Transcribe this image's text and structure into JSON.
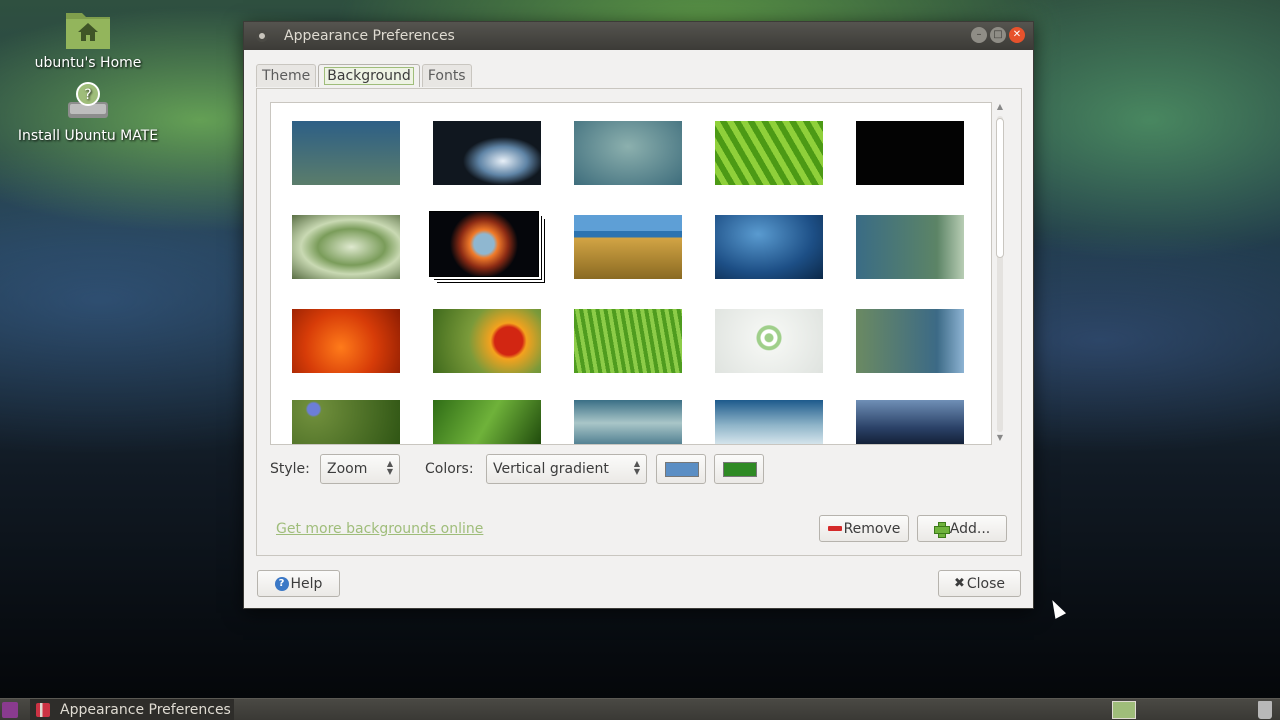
{
  "desktop": {
    "icons": [
      {
        "label": "ubuntu's Home",
        "icon": "home-folder-icon"
      },
      {
        "label": "Install Ubuntu MATE",
        "icon": "installer-disk-icon"
      }
    ]
  },
  "window": {
    "title": "Appearance Preferences",
    "controls": [
      "minimize",
      "maximize",
      "close"
    ]
  },
  "tabs": [
    {
      "label": "Theme",
      "active": false
    },
    {
      "label": "Background",
      "active": true
    },
    {
      "label": "Fonts",
      "active": false
    }
  ],
  "gallery": {
    "selected_index": 6
  },
  "style": {
    "label": "Style:",
    "value": "Zoom"
  },
  "colors": {
    "label": "Colors:",
    "value": "Vertical gradient",
    "primary": "#5b8ec4",
    "secondary": "#2f8a24"
  },
  "links": {
    "more_backgrounds": "Get more backgrounds online"
  },
  "buttons": {
    "remove": "Remove",
    "add": "Add...",
    "help": "Help",
    "close": "Close"
  },
  "taskbar": {
    "task_label": "Appearance Preferences"
  },
  "theme": {
    "accent": "#9fbd7a",
    "titlebar": "#3c3b37",
    "window_bg": "#f2f1f0"
  }
}
